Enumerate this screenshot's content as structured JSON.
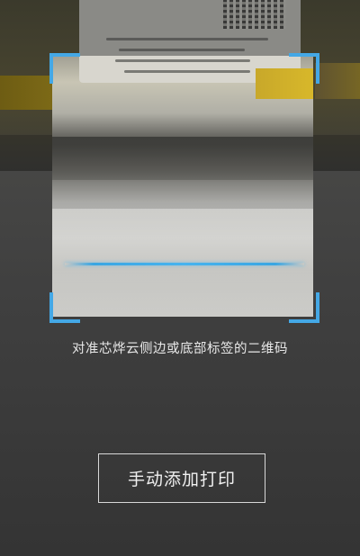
{
  "scanner": {
    "hint": "对准芯烨云侧边或底部标签的二维码",
    "accent_color": "#44a8e6",
    "scan_line_color": "#47b3ee"
  },
  "actions": {
    "manual_add_print_label": "手动添加打印"
  }
}
